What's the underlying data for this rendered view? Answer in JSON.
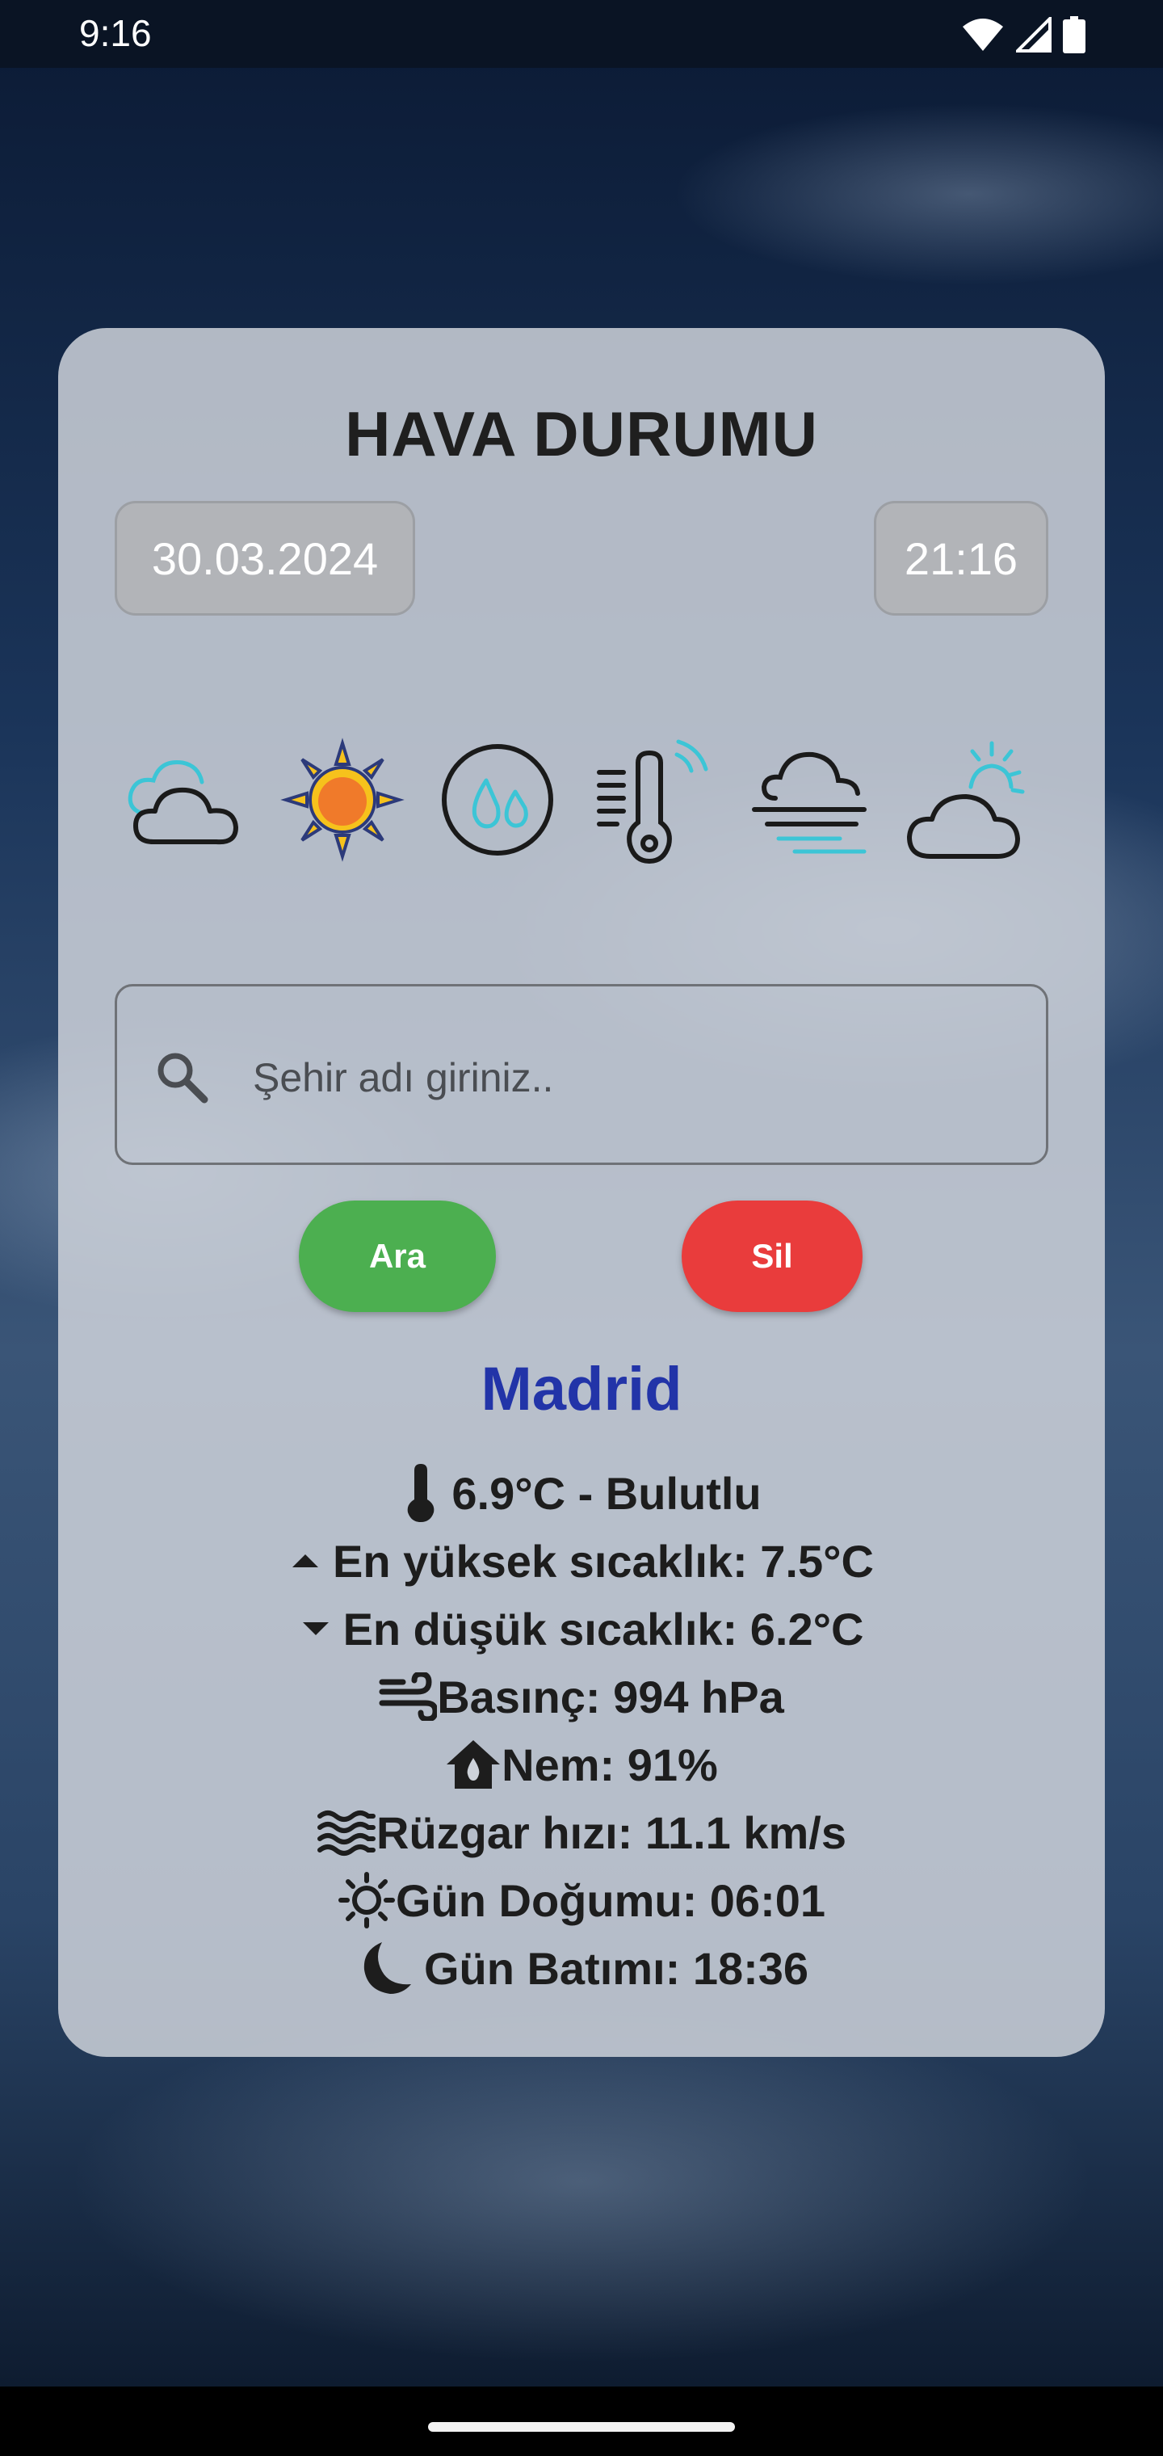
{
  "status_bar": {
    "time": "9:16"
  },
  "app": {
    "title": "HAVA DURUMU",
    "date": "30.03.2024",
    "time": "21:16"
  },
  "weather_icons": [
    "cloud-icon",
    "sun-icon",
    "humidity-drops-icon",
    "thermometer-icon",
    "fog-icon",
    "partly-cloudy-icon"
  ],
  "search": {
    "placeholder": "Şehir adı giriniz..",
    "value": ""
  },
  "buttons": {
    "search_label": "Ara",
    "clear_label": "Sil"
  },
  "colors": {
    "search_button": "#4caf50",
    "clear_button": "#e93c3c",
    "city": "#2234a8"
  },
  "result": {
    "city": "Madrid",
    "temperature_line": "6.9°C - Bulutlu",
    "max_temp": "En yüksek sıcaklık: 7.5°C",
    "min_temp": "En düşük sıcaklık: 6.2°C",
    "pressure": "Basınç: 994 hPa",
    "humidity": "Nem: 91%",
    "wind": "Rüzgar hızı: 11.1 km/s",
    "sunrise": "Gün Doğumu: 06:01",
    "sunset": "Gün Batımı: 18:36"
  }
}
